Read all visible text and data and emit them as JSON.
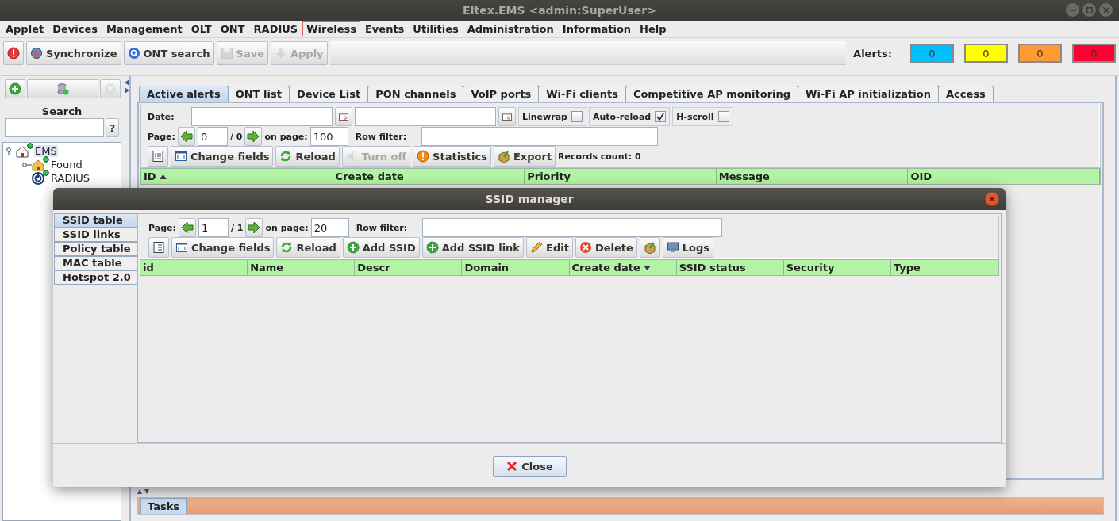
{
  "window": {
    "title": "Eltex.EMS <admin:SuperUser>"
  },
  "menu": [
    {
      "label": "Applet",
      "selected": false
    },
    {
      "label": "Devices",
      "selected": false
    },
    {
      "label": "Management",
      "selected": false
    },
    {
      "label": "OLT",
      "selected": false
    },
    {
      "label": "ONT",
      "selected": false
    },
    {
      "label": "RADIUS",
      "selected": false
    },
    {
      "label": "Wireless",
      "selected": true
    },
    {
      "label": "Events",
      "selected": false
    },
    {
      "label": "Utilities",
      "selected": false
    },
    {
      "label": "Administration",
      "selected": false
    },
    {
      "label": "Information",
      "selected": false
    },
    {
      "label": "Help",
      "selected": false
    }
  ],
  "toolbar": {
    "buttons": [
      {
        "kind": "alarm",
        "disabled": false
      },
      {
        "kind": "globe",
        "label": "Synchronize",
        "disabled": false
      },
      {
        "kind": "search",
        "label": "ONT search",
        "disabled": false
      },
      {
        "kind": "save",
        "label": "Save",
        "disabled": true
      },
      {
        "kind": "apply",
        "label": "Apply",
        "disabled": true
      }
    ],
    "alerts": {
      "label": "Alerts:",
      "counters": [
        {
          "value": "0",
          "color": "#00bfff"
        },
        {
          "value": "0",
          "color": "#ffff00"
        },
        {
          "value": "0",
          "color": "#ff9933"
        },
        {
          "value": "0",
          "color": "#ff0033"
        }
      ]
    }
  },
  "sidebar": {
    "buttons": [
      {
        "kind": "add",
        "disabled": false
      },
      {
        "kind": "database",
        "disabled": false
      },
      {
        "kind": "remove",
        "disabled": true
      }
    ],
    "search": {
      "label": "Search",
      "help": "?"
    },
    "tree": [
      {
        "label": "EMS",
        "kind": "home",
        "selected": true,
        "expanded": true,
        "children": [
          {
            "label": "Found",
            "kind": "folder",
            "selected": false,
            "expanded": false
          },
          {
            "label": "RADIUS",
            "kind": "radius",
            "selected": false
          }
        ]
      }
    ]
  },
  "main": {
    "tabs": [
      {
        "label": "Active alerts",
        "selected": true
      },
      {
        "label": "ONT list",
        "selected": false
      },
      {
        "label": "Device List",
        "selected": false
      },
      {
        "label": "PON channels",
        "selected": false
      },
      {
        "label": "VoIP ports",
        "selected": false
      },
      {
        "label": "Wi-Fi clients",
        "selected": false
      },
      {
        "label": "Competitive AP monitoring",
        "selected": false
      },
      {
        "label": "Wi-Fi AP initialization",
        "selected": false
      },
      {
        "label": "Access",
        "selected": false
      }
    ],
    "filter": {
      "date_label": "Date:",
      "options": [
        {
          "label": "Linewrap",
          "checked": false
        },
        {
          "label": "Auto-reload",
          "checked": true
        },
        {
          "label": "H-scroll",
          "checked": false
        }
      ]
    },
    "paging": {
      "page_label": "Page:",
      "page": "0",
      "total": "/ 0",
      "per_page_label": "on page:",
      "per_page": "100",
      "row_filter_label": "Row filter:"
    },
    "actions": [
      {
        "kind": "list",
        "disabled": false
      },
      {
        "kind": "fields",
        "label": "Change fields",
        "disabled": false
      },
      {
        "kind": "reload",
        "label": "Reload",
        "disabled": false
      },
      {
        "kind": "sound",
        "label": "Turn off",
        "disabled": true
      },
      {
        "kind": "stats",
        "label": "Statistics",
        "disabled": false
      },
      {
        "kind": "export",
        "label": "Export",
        "disabled": false
      }
    ],
    "records": "Records count: 0",
    "columns": [
      {
        "label": "ID",
        "sorted": true,
        "descending": false
      },
      {
        "label": "Create date",
        "sorted": false
      },
      {
        "label": "Priority",
        "sorted": false
      },
      {
        "label": "Message",
        "sorted": false
      },
      {
        "label": "OID",
        "sorted": false
      }
    ]
  },
  "dialog": {
    "title": "SSID manager",
    "sections": [
      {
        "label": "SSID table",
        "selected": true
      },
      {
        "label": "SSID links",
        "selected": false
      },
      {
        "label": "Policy table",
        "selected": false
      },
      {
        "label": "MAC table",
        "selected": false
      },
      {
        "label": "Hotspot 2.0",
        "selected": false
      }
    ],
    "paging": {
      "page_label": "Page:",
      "page": "1",
      "total": "/ 1",
      "per_page_label": "on page:",
      "per_page": "20",
      "row_filter_label": "Row filter:"
    },
    "actions": [
      {
        "kind": "list",
        "disabled": false
      },
      {
        "kind": "fields",
        "label": "Change fields",
        "disabled": false
      },
      {
        "kind": "reload",
        "label": "Reload",
        "disabled": false
      },
      {
        "kind": "add",
        "label": "Add SSID",
        "disabled": false
      },
      {
        "kind": "add",
        "label": "Add SSID link",
        "disabled": false
      },
      {
        "kind": "edit",
        "label": "Edit",
        "disabled": false
      },
      {
        "kind": "delete",
        "label": "Delete",
        "disabled": false
      },
      {
        "kind": "export",
        "disabled": false
      },
      {
        "kind": "logs",
        "label": "Logs",
        "disabled": false
      }
    ],
    "columns": [
      {
        "label": "id",
        "sorted": false
      },
      {
        "label": "Name",
        "sorted": false
      },
      {
        "label": "Descr",
        "sorted": false
      },
      {
        "label": "Domain",
        "sorted": false
      },
      {
        "label": "Create date",
        "sorted": true,
        "descending": true
      },
      {
        "label": "SSID status",
        "sorted": false
      },
      {
        "label": "Security",
        "sorted": false
      },
      {
        "label": "Type",
        "sorted": false
      }
    ],
    "close": "Close"
  },
  "tasks": {
    "tabs": [
      {
        "label": "Tasks",
        "selected": true
      }
    ]
  }
}
